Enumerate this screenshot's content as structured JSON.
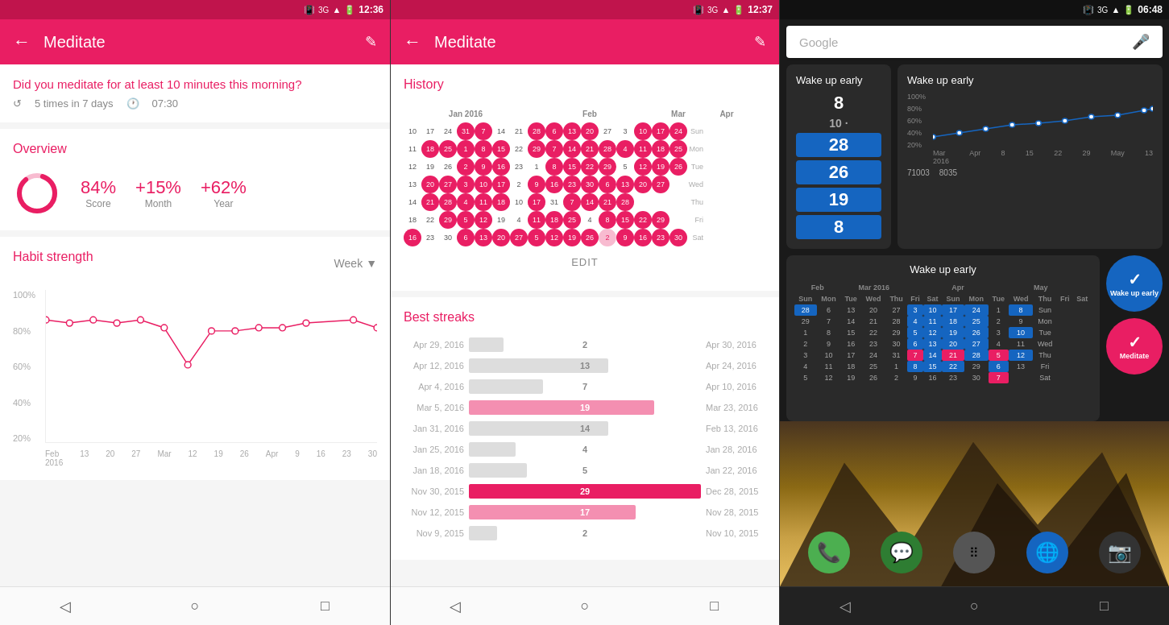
{
  "screen1": {
    "statusBar": {
      "time": "12:36",
      "signal": "36",
      "battery": "█"
    },
    "appBar": {
      "title": "Meditate",
      "back": "←",
      "edit": "✎"
    },
    "questionCard": {
      "text": "Did you meditate for at least 10 minutes this morning?",
      "frequency": "5 times in 7 days",
      "time": "07:30"
    },
    "overview": {
      "title": "Overview",
      "score": {
        "value": "84%",
        "label": "Score",
        "percent": 84
      },
      "month": {
        "value": "+15%",
        "label": "Month"
      },
      "year": {
        "value": "+62%",
        "label": "Year"
      }
    },
    "habitStrength": {
      "title": "Habit strength",
      "period": "Week",
      "yLabels": [
        "100%",
        "80%",
        "60%",
        "40%",
        "20%"
      ],
      "xLabels": [
        "Feb",
        "13",
        "20",
        "27",
        "Mar",
        "12",
        "19",
        "26",
        "Apr",
        "9",
        "16",
        "23",
        "30"
      ],
      "x2Labels": [
        "2016",
        "",
        "",
        "",
        "",
        "",
        "",
        "",
        "",
        "",
        "",
        "",
        ""
      ]
    }
  },
  "screen2": {
    "statusBar": {
      "time": "12:37"
    },
    "appBar": {
      "title": "Meditate"
    },
    "history": {
      "title": "History",
      "months": [
        "Jan 2016",
        "Feb",
        "Mar",
        "Apr"
      ],
      "dayLabels": [
        "Sun",
        "Mon",
        "Tue",
        "Wed",
        "Thu",
        "Fri",
        "Sat"
      ]
    },
    "editBtn": "EDIT",
    "bestStreaks": {
      "title": "Best streaks",
      "streaks": [
        {
          "start": "Apr 29, 2016",
          "count": "2",
          "end": "Apr 30, 2016",
          "type": "light"
        },
        {
          "start": "Apr 12, 2016",
          "count": "13",
          "end": "Apr 24, 2016",
          "type": "light"
        },
        {
          "start": "Apr 4, 2016",
          "count": "7",
          "end": "Apr 10, 2016",
          "type": "light"
        },
        {
          "start": "Mar 5, 2016",
          "count": "19",
          "end": "Mar 23, 2016",
          "type": "pink"
        },
        {
          "start": "Jan 31, 2016",
          "count": "14",
          "end": "Feb 13, 2016",
          "type": "light"
        },
        {
          "start": "Jan 25, 2016",
          "count": "4",
          "end": "Jan 28, 2016",
          "type": "light"
        },
        {
          "start": "Jan 18, 2016",
          "count": "5",
          "end": "Jan 22, 2016",
          "type": "light"
        },
        {
          "start": "Nov 30, 2015",
          "count": "29",
          "end": "Dec 28, 2015",
          "type": "red"
        },
        {
          "start": "Nov 12, 2015",
          "count": "17",
          "end": "Nov 28, 2015",
          "type": "pink"
        },
        {
          "start": "Nov 9, 2015",
          "count": "2",
          "end": "Nov 10, 2015",
          "type": "light"
        }
      ]
    }
  },
  "screen3": {
    "statusBar": {
      "time": "06:48"
    },
    "googleBar": {
      "placeholder": "Google",
      "mic": "🎤"
    },
    "wakeWidget": {
      "title": "Wake up early",
      "numbers": [
        "8",
        "10",
        "28",
        "26",
        "19",
        "8"
      ]
    },
    "chartWidget": {
      "title": "Wake up early",
      "stats": "71003  8035",
      "yLabels": [
        "100%",
        "80%",
        "60%",
        "40%",
        "20%"
      ],
      "xLabels": [
        "Mar 2016",
        "Apr",
        "8",
        "15",
        "22",
        "29",
        "May",
        "13"
      ]
    },
    "calendarWidget": {
      "title": "Wake up early",
      "months": [
        "Feb",
        "Mar 2016",
        "Apr",
        "May"
      ],
      "dayLabels": [
        "Sun",
        "Mon",
        "Tue",
        "Wed",
        "Thu",
        "Fri",
        "Sat"
      ]
    },
    "fabButtons": [
      {
        "label": "Wake up early",
        "type": "blue",
        "icon": "✓"
      },
      {
        "label": "Meditate",
        "type": "pink",
        "icon": "✓"
      }
    ],
    "appIcons": [
      {
        "name": "phone",
        "emoji": "📞",
        "bg": "#4caf50"
      },
      {
        "name": "chat",
        "emoji": "💬",
        "bg": "#388e3c"
      },
      {
        "name": "apps",
        "emoji": "⠿",
        "bg": "#555"
      },
      {
        "name": "browser",
        "emoji": "🌐",
        "bg": "#1565c0"
      },
      {
        "name": "camera",
        "emoji": "📷",
        "bg": "#333"
      }
    ]
  },
  "nav": {
    "back": "◁",
    "home": "○",
    "square": "□"
  }
}
